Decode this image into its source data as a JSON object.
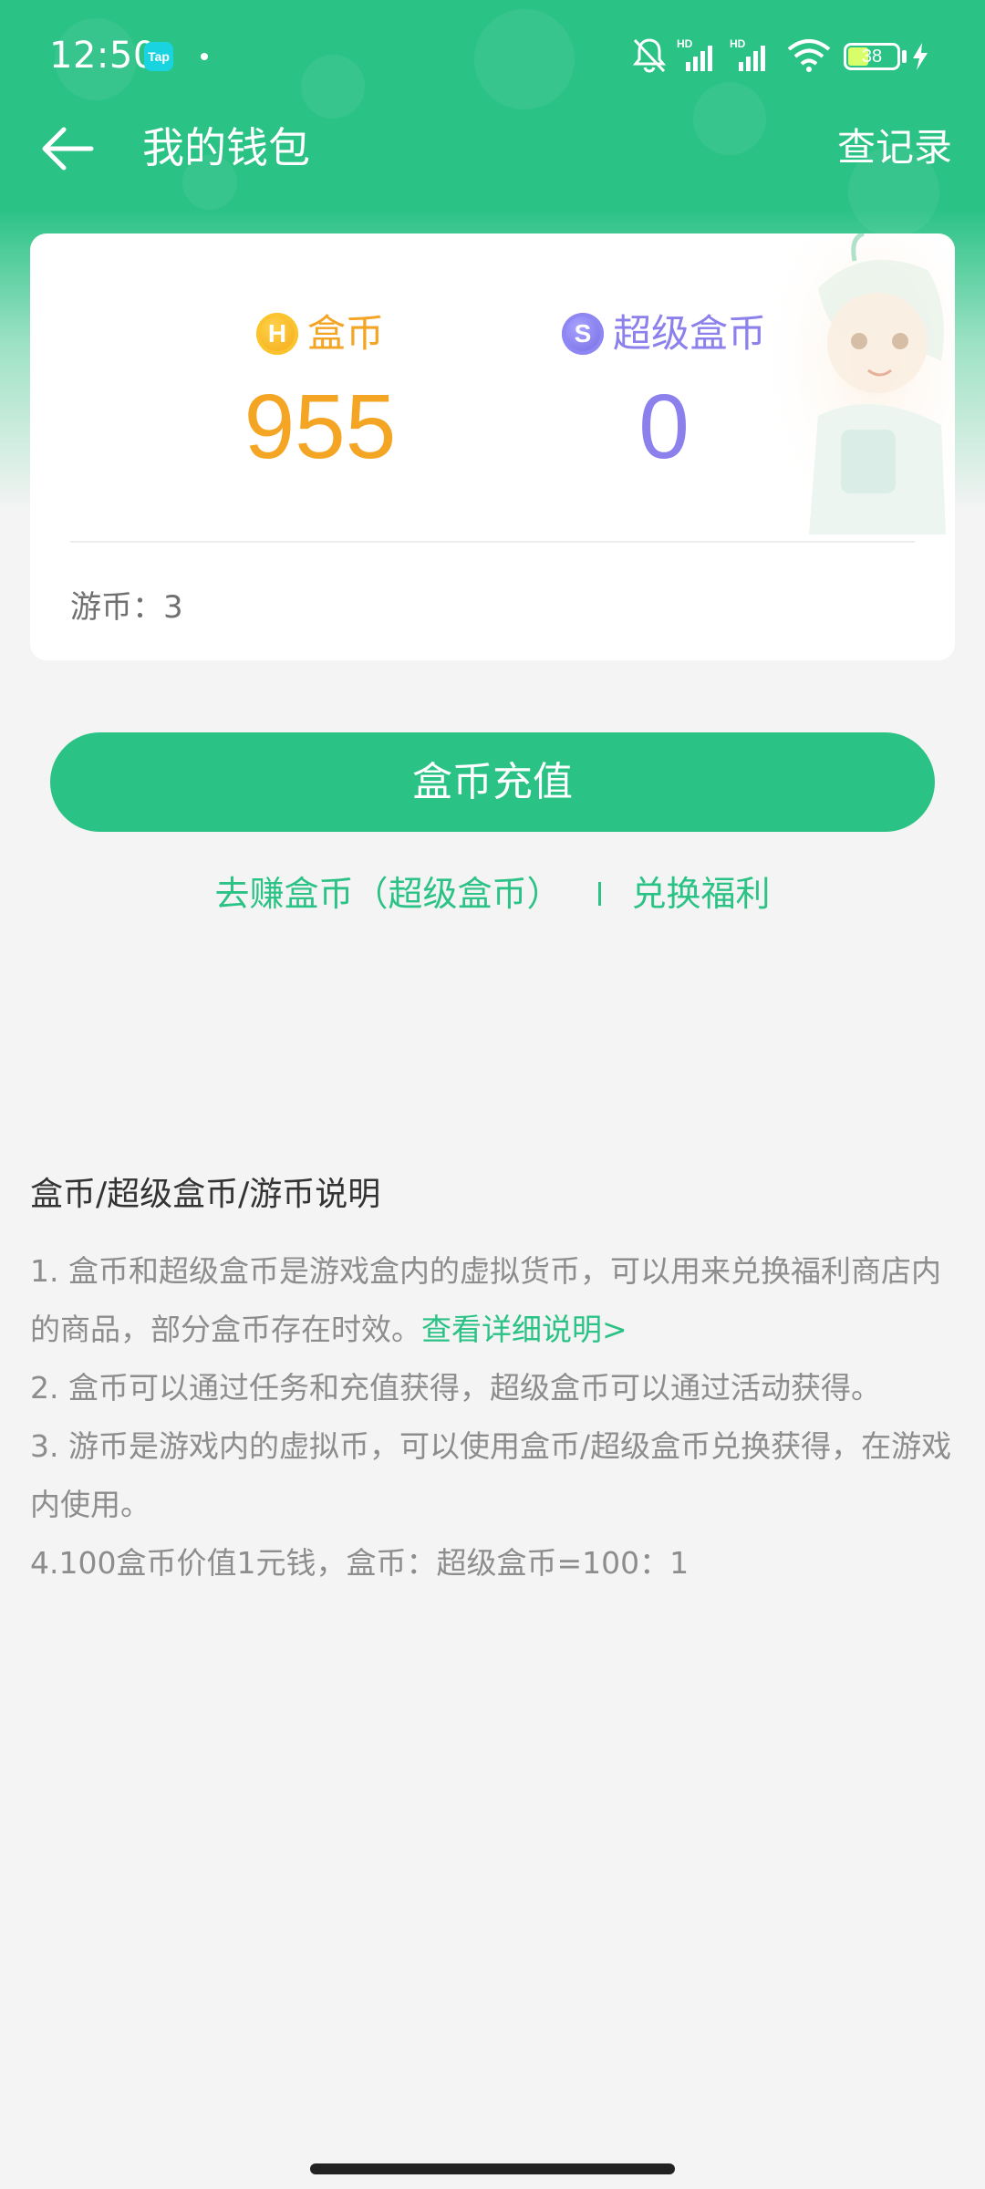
{
  "status_bar": {
    "time": "12:50",
    "app_badge": "Tap",
    "battery": "38"
  },
  "nav": {
    "title": "我的钱包",
    "records_label": "查记录"
  },
  "wallet": {
    "gold_coin_label": "盒币",
    "gold_coin_icon_letter": "H",
    "gold_coin_value": "955",
    "super_coin_label": "超级盒币",
    "super_coin_icon_letter": "S",
    "super_coin_value": "0",
    "game_coin": "游币：3"
  },
  "actions": {
    "recharge_label": "盒币充值",
    "earn_label": "去赚盒币（超级盒币）",
    "exchange_label": "兑换福利"
  },
  "explanation": {
    "title": "盒币/超级盒币/游币说明",
    "line1": "1. 盒币和超级盒币是游戏盒内的虚拟货币，可以用来兑换福利商店内的商品，部分盒币存在时效。",
    "line1_link": "查看详细说明>",
    "line2": "2. 盒币可以通过任务和充值获得，超级盒币可以通过活动获得。",
    "line3": "3. 游币是游戏内的虚拟币，可以使用盒币/超级盒币兑换获得，在游戏内使用。",
    "line4": "4.100盒币价值1元钱，盒币：超级盒币=100：1"
  },
  "colors": {
    "brand_green": "#2bc286",
    "gold": "#f5a524",
    "super_purple": "#8b80ec"
  }
}
